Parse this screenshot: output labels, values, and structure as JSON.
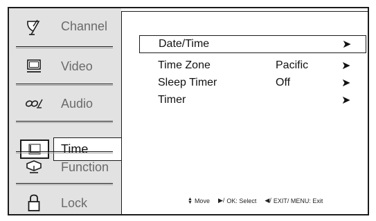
{
  "sidebar": {
    "items": [
      {
        "label": "Channel",
        "icon": "satellite-dish-icon"
      },
      {
        "label": "Video",
        "icon": "monitor-icon"
      },
      {
        "label": "Audio",
        "icon": "audio-icon"
      },
      {
        "label": "Time",
        "icon": "clock-icon",
        "active": true
      },
      {
        "label": "Function",
        "icon": "function-icon"
      },
      {
        "label": "Lock",
        "icon": "lock-icon"
      }
    ]
  },
  "menu": {
    "rows": [
      {
        "name": "Date/Time",
        "value": "",
        "arrow": "➤",
        "selected": true
      },
      {
        "name": "Time Zone",
        "value": "Pacific",
        "arrow": "➤"
      },
      {
        "name": "Sleep Timer",
        "value": "Off",
        "arrow": "➤"
      },
      {
        "name": "Timer",
        "value": "",
        "arrow": "➤"
      }
    ]
  },
  "hint": {
    "move": "Move",
    "select_symbol": "▶/",
    "select": "OK: Select",
    "exit_symbol": "◀/",
    "exit": "EXIT/ MENU: Exit"
  }
}
